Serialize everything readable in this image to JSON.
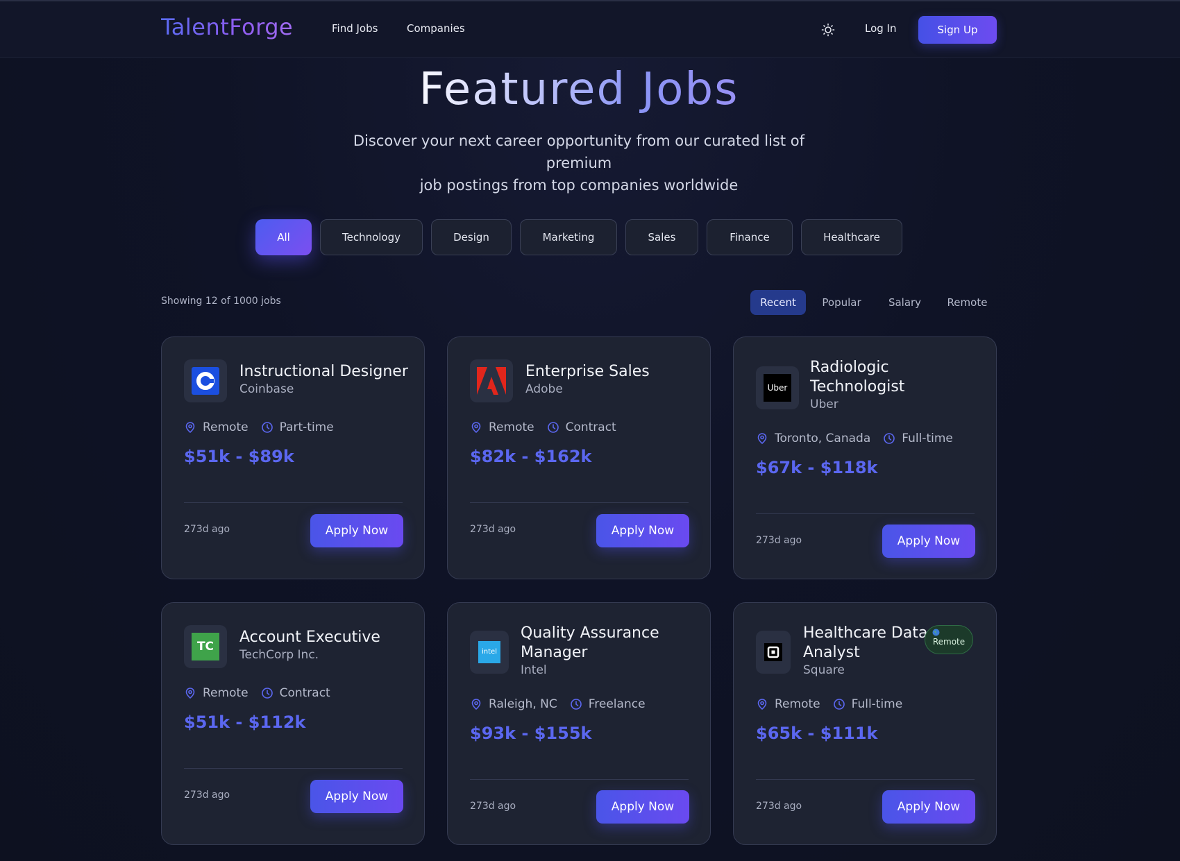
{
  "nav": {
    "logo": "TalentForge",
    "links": [
      "Find Jobs",
      "Companies"
    ],
    "login": "Log In",
    "signup": "Sign Up"
  },
  "hero": {
    "title": "Featured Jobs",
    "subtitle_line1": "Discover your next career opportunity from our curated list of premium",
    "subtitle_line2": "job postings from top companies worldwide"
  },
  "filters": [
    "All",
    "Technology",
    "Design",
    "Marketing",
    "Sales",
    "Finance",
    "Healthcare"
  ],
  "active_filter": "All",
  "results": {
    "count_text": "Showing 12 of 1000 jobs"
  },
  "sort": [
    "Recent",
    "Popular",
    "Salary",
    "Remote"
  ],
  "active_sort": "Recent",
  "apply_label": "Apply Now",
  "colors": {
    "accent": "#5b67f0",
    "brand_gradient_start": "#4d5cf0",
    "brand_gradient_end": "#7b4ff0",
    "card_bg": "#1e2332"
  },
  "jobs": [
    {
      "title_line1": "Instructional Designer",
      "title_line2": "",
      "company": "Coinbase",
      "location": "Remote",
      "type": "Part-time",
      "salary": "$51k - $89k",
      "posted": "273d ago",
      "logo_icon": "coinbase-logo-icon"
    },
    {
      "title_line1": "Enterprise Sales",
      "title_line2": "",
      "company": "Adobe",
      "location": "Remote",
      "type": "Contract",
      "salary": "$82k - $162k",
      "posted": "273d ago",
      "logo_icon": "adobe-logo-icon"
    },
    {
      "title_line1": "Radiologic",
      "title_line2": "Technologist",
      "company": "Uber",
      "location": "Toronto, Canada",
      "type": "Full-time",
      "salary": "$67k - $118k",
      "posted": "273d ago",
      "logo_icon": "uber-logo-icon",
      "logo_text": "Uber"
    },
    {
      "title_line1": "Account Executive",
      "title_line2": "",
      "company": "TechCorp Inc.",
      "location": "Remote",
      "type": "Contract",
      "salary": "$51k - $112k",
      "posted": "273d ago",
      "logo_icon": "techcrunch-logo-icon",
      "logo_text": "TC"
    },
    {
      "title_line1": "Quality Assurance",
      "title_line2": "Manager",
      "company": "Intel",
      "location": "Raleigh, NC",
      "type": "Freelance",
      "salary": "$93k - $155k",
      "posted": "273d ago",
      "logo_icon": "intel-logo-icon",
      "logo_text": "intel"
    },
    {
      "title_line1": "Healthcare Data",
      "title_line2": "Analyst",
      "company": "Square",
      "location": "Remote",
      "type": "Full-time",
      "salary": "$65k - $111k",
      "posted": "273d ago",
      "logo_icon": "square-logo-icon",
      "badge": "Remote"
    }
  ]
}
